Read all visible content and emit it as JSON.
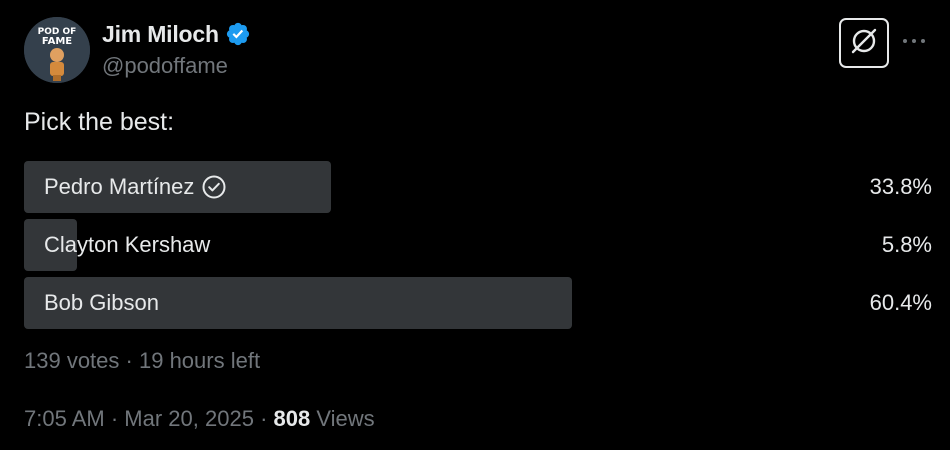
{
  "author": {
    "display_name": "Jim Miloch",
    "handle": "@podoffame",
    "avatar_text": "POD OF FAME",
    "verified": true
  },
  "tweet": {
    "text": "Pick the best:"
  },
  "poll": {
    "options": [
      {
        "label": "Pedro Martínez",
        "percent_label": "33.8%",
        "percent": 33.8,
        "selected": true
      },
      {
        "label": "Clayton Kershaw",
        "percent_label": "5.8%",
        "percent": 5.8,
        "selected": false
      },
      {
        "label": "Bob Gibson",
        "percent_label": "60.4%",
        "percent": 60.4,
        "selected": false
      }
    ],
    "votes": "139 votes",
    "separator": "·",
    "time_left": "19 hours left"
  },
  "meta": {
    "time": "7:05 AM",
    "separator": "·",
    "date": "Mar 20, 2025",
    "views_count": "808",
    "views_label": "Views"
  },
  "colors": {
    "background": "#000000",
    "text": "#e7e9ea",
    "muted": "#71767b",
    "poll_bar": "#333639",
    "verified": "#1d9bf0"
  },
  "icons": {
    "verified": "verified-badge-icon",
    "grok": "grok-icon",
    "more": "more-horizontal-icon",
    "poll_check": "check-circle-icon"
  }
}
